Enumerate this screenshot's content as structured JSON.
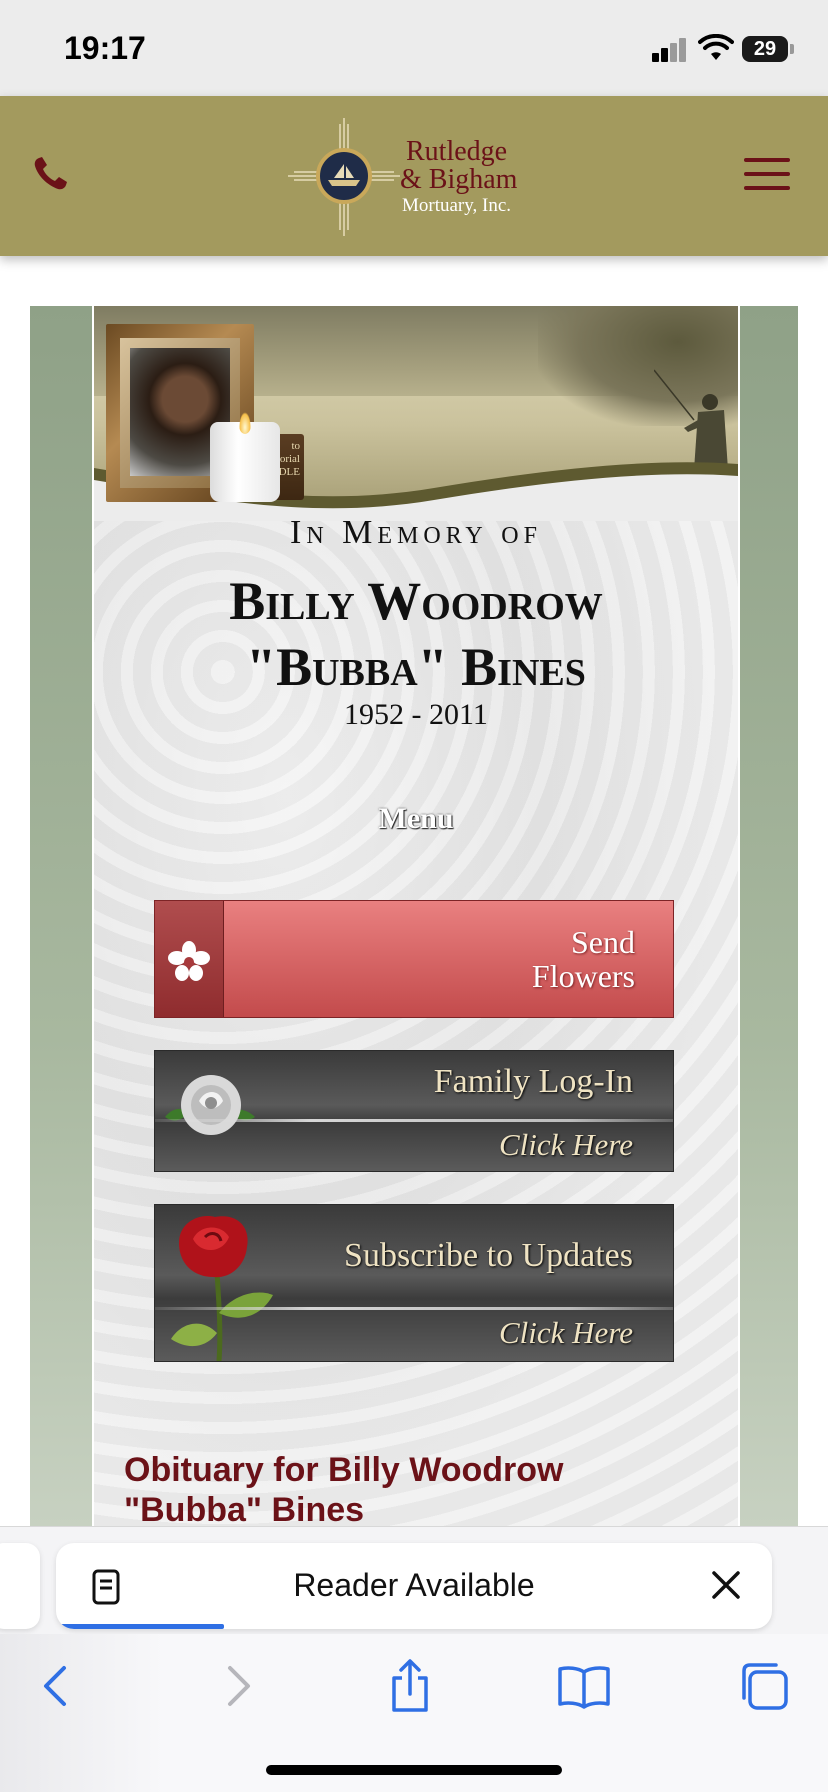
{
  "status_bar": {
    "time": "19:17",
    "battery": "29",
    "icons": [
      "signal-icon",
      "wifi-icon",
      "battery-icon"
    ]
  },
  "header": {
    "logo": {
      "line1": "Rutledge",
      "line2": "& Bigham",
      "line3": "Mortuary, Inc."
    },
    "icons": [
      "phone-icon",
      "hamburger-menu-icon"
    ],
    "colors": {
      "bar": "#a39a5e",
      "accent": "#6b1218"
    }
  },
  "memorial": {
    "candle_label_line1": "to",
    "candle_label_line2": "...orial",
    "candle_label_line3": "CANDLE",
    "in_memory_of": "In Memory of",
    "name_line1": "Billy Woodrow",
    "name_line2": "\"Bubba\" Bines",
    "years": "1952 - 2011",
    "menu_label": "Menu"
  },
  "buttons": {
    "send_flowers_line1": "Send",
    "send_flowers_line2": "Flowers",
    "family_login_title": "Family Log-In",
    "family_login_click": "Click Here",
    "subscribe_title": "Subscribe to Updates",
    "subscribe_click": "Click Here"
  },
  "obituary": {
    "heading_line1": "Obituary for Billy Woodrow",
    "heading_line2": "\"Bubba\" Bines"
  },
  "safari": {
    "reader_text": "Reader Available",
    "toolbar_icons": [
      "back-icon",
      "forward-icon",
      "share-icon",
      "bookmarks-icon",
      "tabs-icon"
    ],
    "accent": "#2f6fe4"
  }
}
